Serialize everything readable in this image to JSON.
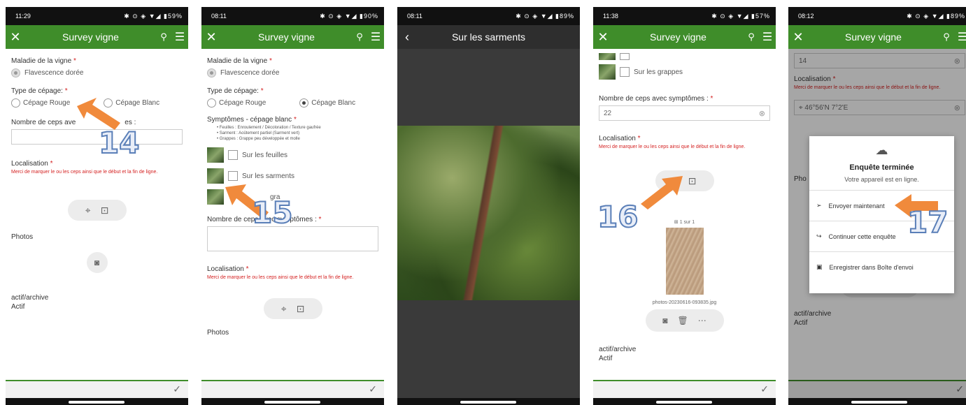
{
  "screens": [
    {
      "status": {
        "time": "11:29",
        "icons": "✱ ⊙ ◈ ▼◢ ▮59%"
      },
      "title": "Survey vigne",
      "maladie_label": "Maladie de la vigne",
      "maladie_value": "Flavescence dorée",
      "type_label": "Type de cépage:",
      "opt_rouge": "Cépage Rouge",
      "opt_blanc": "Cépage Blanc",
      "nombre_label": "Nombre de ceps ave",
      "nombre_label_tail": "es :",
      "localisation_label": "Localisation",
      "localisation_hint": "Merci de marquer le ou les ceps ainsi que le début et la fin de ligne.",
      "photos_label": "Photos",
      "actif_label": "actif/archive",
      "actif_value": "Actif",
      "annotation": "14"
    },
    {
      "status": {
        "time": "08:11",
        "icons": "✱ ⊙ ◈ ▼◢ ▮90%"
      },
      "title": "Survey vigne",
      "maladie_label": "Maladie de la vigne",
      "maladie_value": "Flavescence dorée",
      "type_label": "Type de cépage:",
      "opt_rouge": "Cépage Rouge",
      "opt_blanc": "Cépage Blanc",
      "symptomes_label": "Symptômes - cépage blanc",
      "sym_items": [
        "• Feuilles : Enroulement / Décoloration / Texture gaufrée",
        "• Sarment : Aoûtement partiel (Sarment vert)",
        "• Grappes : Grappe peu développée et molle"
      ],
      "photo_feuilles": "Sur les feuilles",
      "photo_sarments": "Sur les sarments",
      "photo_grappes": "gra",
      "nombre_label": "Nombre de ceps avec symptômes :",
      "localisation_label": "Localisation",
      "localisation_hint": "Merci de marquer le ou les ceps ainsi que le début et la fin de ligne.",
      "photos_label": "Photos",
      "annotation": "15"
    },
    {
      "status": {
        "time": "08:11",
        "icons": "✱ ⊙ ◈ ▼◢ ▮89%"
      },
      "title": "Sur les sarments"
    },
    {
      "status": {
        "time": "11:38",
        "icons": "✱ ⊙ ◈ ▼◢ ▮57%"
      },
      "title": "Survey vigne",
      "photo_grappes": "Sur les grappes",
      "nombre_label": "Nombre de ceps avec symptômes :",
      "nombre_value": "22",
      "localisation_label": "Localisation",
      "localisation_hint": "Merci de marquer le ou les ceps ainsi que le début et la fin de ligne.",
      "counter": "1 sur 1",
      "filename": "photos-20230616-093835.jpg",
      "actif_label": "actif/archive",
      "actif_value": "Actif",
      "annotation": "16"
    },
    {
      "status": {
        "time": "08:12",
        "icons": "✱ ⊙ ◈ ▼◢ ▮89%"
      },
      "title": "Survey vigne",
      "nombre_value": "14",
      "localisation_label": "Localisation",
      "localisation_hint": "Merci de marquer le ou les ceps ainsi que le début et la fin de ligne.",
      "coords": "46°56'N 7°2'E",
      "photos_label": "Pho",
      "actif_label": "actif/archive",
      "actif_value": "Actif",
      "dialog_title": "Enquête terminée",
      "dialog_sub": "Votre appareil est en ligne.",
      "dialog_send": "Envoyer maintenant",
      "dialog_continue": "Continuer cette enquête",
      "dialog_save": "Enregistrer dans Boîte d'envoi",
      "annotation": "17"
    }
  ],
  "colors": {
    "appbar": "#3f8d2a",
    "required": "#d42020",
    "arrow": "#f08a3c"
  }
}
